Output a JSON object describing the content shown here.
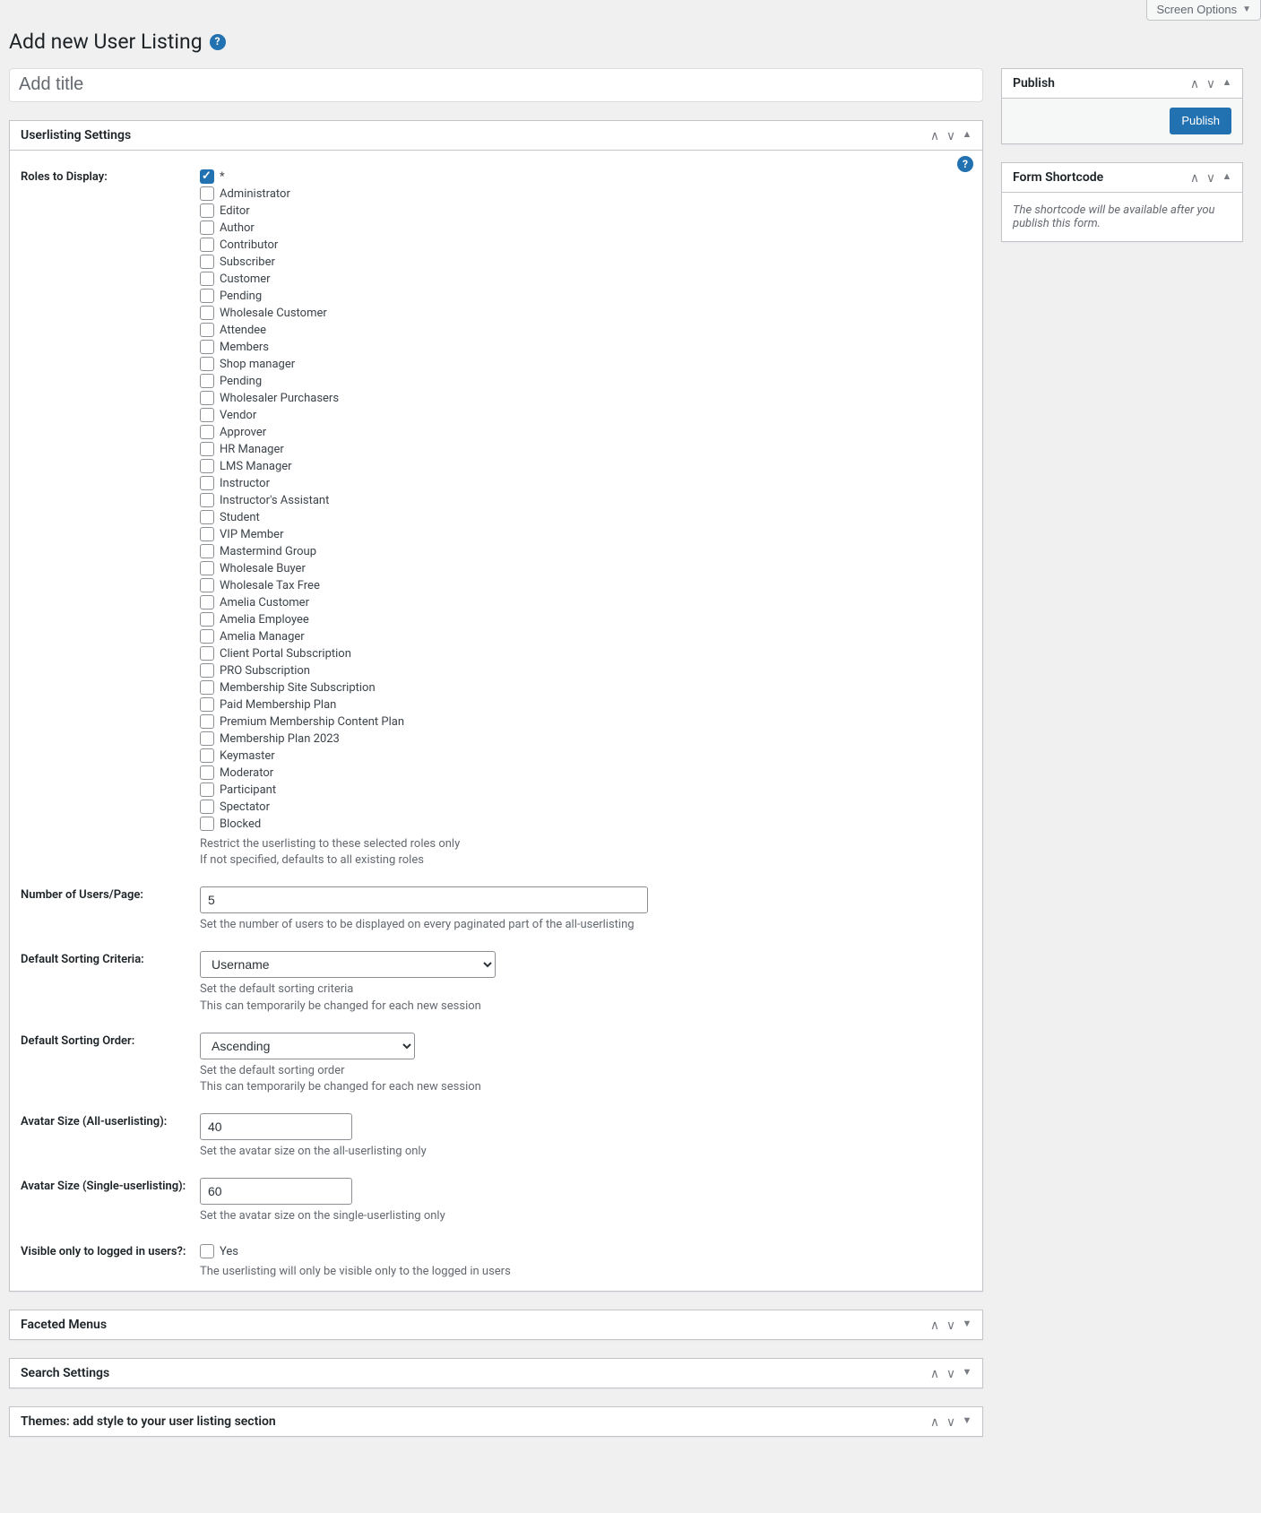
{
  "screenOptions": "Screen Options",
  "pageTitle": "Add new User Listing",
  "titlePlaceholder": "Add title",
  "titleValue": "",
  "settingsBox": {
    "title": "Userlisting Settings"
  },
  "roles": {
    "label": "Roles to Display:",
    "items": [
      {
        "label": "*",
        "checked": true
      },
      {
        "label": "Administrator",
        "checked": false
      },
      {
        "label": "Editor",
        "checked": false
      },
      {
        "label": "Author",
        "checked": false
      },
      {
        "label": "Contributor",
        "checked": false
      },
      {
        "label": "Subscriber",
        "checked": false
      },
      {
        "label": "Customer",
        "checked": false
      },
      {
        "label": "Pending",
        "checked": false
      },
      {
        "label": "Wholesale Customer",
        "checked": false
      },
      {
        "label": "Attendee",
        "checked": false
      },
      {
        "label": "Members",
        "checked": false
      },
      {
        "label": "Shop manager",
        "checked": false
      },
      {
        "label": "Pending",
        "checked": false
      },
      {
        "label": "Wholesaler Purchasers",
        "checked": false
      },
      {
        "label": "Vendor",
        "checked": false
      },
      {
        "label": "Approver",
        "checked": false
      },
      {
        "label": "HR Manager",
        "checked": false
      },
      {
        "label": "LMS Manager",
        "checked": false
      },
      {
        "label": "Instructor",
        "checked": false
      },
      {
        "label": "Instructor's Assistant",
        "checked": false
      },
      {
        "label": "Student",
        "checked": false
      },
      {
        "label": "VIP Member",
        "checked": false
      },
      {
        "label": "Mastermind Group",
        "checked": false
      },
      {
        "label": "Wholesale Buyer",
        "checked": false
      },
      {
        "label": "Wholesale Tax Free",
        "checked": false
      },
      {
        "label": "Amelia Customer",
        "checked": false
      },
      {
        "label": "Amelia Employee",
        "checked": false
      },
      {
        "label": "Amelia Manager",
        "checked": false
      },
      {
        "label": "Client Portal Subscription",
        "checked": false
      },
      {
        "label": "PRO Subscription",
        "checked": false
      },
      {
        "label": "Membership Site Subscription",
        "checked": false
      },
      {
        "label": "Paid Membership Plan",
        "checked": false
      },
      {
        "label": "Premium Membership Content Plan",
        "checked": false
      },
      {
        "label": "Membership Plan 2023",
        "checked": false
      },
      {
        "label": "Keymaster",
        "checked": false
      },
      {
        "label": "Moderator",
        "checked": false
      },
      {
        "label": "Participant",
        "checked": false
      },
      {
        "label": "Spectator",
        "checked": false
      },
      {
        "label": "Blocked",
        "checked": false
      }
    ],
    "desc1": "Restrict the userlisting to these selected roles only",
    "desc2": "If not specified, defaults to all existing roles"
  },
  "usersPerPage": {
    "label": "Number of Users/Page:",
    "value": "5",
    "desc": "Set the number of users to be displayed on every paginated part of the all-userlisting"
  },
  "sortCriteria": {
    "label": "Default Sorting Criteria:",
    "value": "Username",
    "desc1": "Set the default sorting criteria",
    "desc2": "This can temporarily be changed for each new session"
  },
  "sortOrder": {
    "label": "Default Sorting Order:",
    "value": "Ascending",
    "desc1": "Set the default sorting order",
    "desc2": "This can temporarily be changed for each new session"
  },
  "avatarAll": {
    "label": "Avatar Size (All-userlisting):",
    "value": "40",
    "desc": "Set the avatar size on the all-userlisting only"
  },
  "avatarSingle": {
    "label": "Avatar Size (Single-userlisting):",
    "value": "60",
    "desc": "Set the avatar size on the single-userlisting only"
  },
  "visibleLogged": {
    "label": "Visible only to logged in users?:",
    "checkboxLabel": "Yes",
    "checked": false,
    "desc": "The userlisting will only be visible only to the logged in users"
  },
  "panels": {
    "faceted": "Faceted Menus",
    "search": "Search Settings",
    "themes": "Themes: add style to your user listing section"
  },
  "publish": {
    "title": "Publish",
    "button": "Publish"
  },
  "shortcode": {
    "title": "Form Shortcode",
    "text": "The shortcode will be available after you publish this form."
  }
}
